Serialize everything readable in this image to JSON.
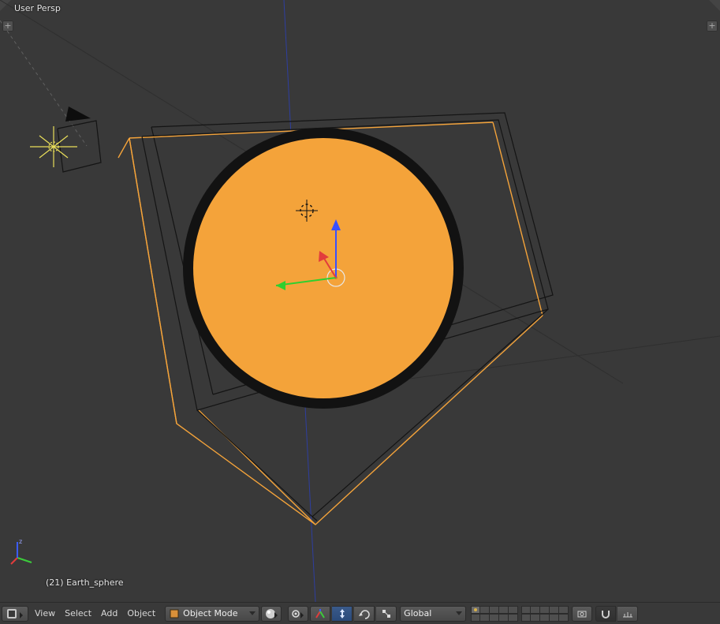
{
  "viewport": {
    "persp_label": "User Persp",
    "object_label": "(21) Earth_sphere"
  },
  "header": {
    "menus": {
      "view": "View",
      "select": "Select",
      "add": "Add",
      "object": "Object"
    },
    "mode": {
      "label": "Object Mode"
    },
    "orientation": {
      "label": "Global"
    },
    "icons": {
      "editor_type": "3dview-editor-icon",
      "mode_icon": "object-mode-icon",
      "shading": "solid-shading-icon",
      "pivot": "median-point-icon",
      "manipulator": "manipulator-icon",
      "translate": "translate-icon",
      "rotate": "rotate-icon",
      "scale": "scale-icon",
      "snap": "snap-magnet-icon",
      "snap_target": "snap-increment-icon",
      "layers": "layers-icon",
      "lock": "camera-lock-icon"
    }
  },
  "colors": {
    "viewport_bg": "#393939",
    "select_orange": "#f4a33a",
    "wire_black": "#1a1a1a",
    "axis_x_red": "#e23c3c",
    "axis_y_green": "#3ccc3c",
    "axis_z_blue": "#3c5cff",
    "light_yellow": "#f7e96f"
  }
}
